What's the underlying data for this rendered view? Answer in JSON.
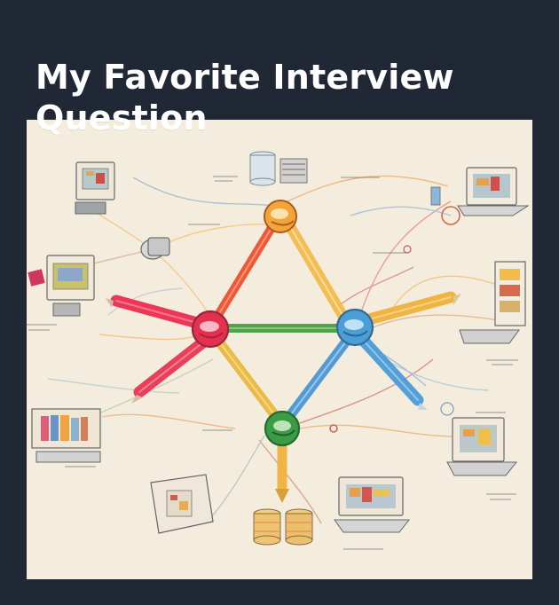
{
  "post": {
    "title": "My Favorite Interview Question"
  },
  "illustration": {
    "icon": "network-graph-sketch-illustration",
    "colors": {
      "background": "#202836",
      "paper": "#f6f0e2",
      "node_orange": "#f2a33a",
      "node_red": "#e5394f",
      "node_blue": "#4d9fd6",
      "node_green": "#3b9c45",
      "edge_yellow": "#f1bb3c"
    }
  }
}
